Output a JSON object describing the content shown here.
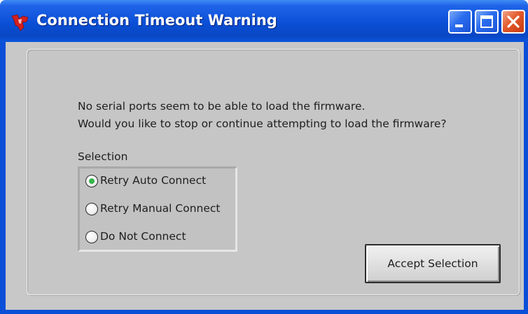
{
  "window": {
    "title": "Connection Timeout Warning",
    "app_icon": "ti-logo-icon",
    "controls": {
      "minimize": "minimize-icon",
      "maximize": "maximize-icon",
      "close": "close-icon"
    }
  },
  "message": {
    "line1": "No serial ports seem to be able to load the firmware.",
    "line2": "Would you like to stop or continue attempting to load the firmware?"
  },
  "selection": {
    "label": "Selection",
    "options": [
      {
        "label": "Retry Auto Connect",
        "selected": true
      },
      {
        "label": "Retry Manual Connect",
        "selected": false
      },
      {
        "label": "Do Not Connect",
        "selected": false
      }
    ]
  },
  "accept_button": {
    "label": "Accept Selection"
  },
  "colors": {
    "titlebar": "#0a4fd6",
    "background": "#c8c8c8",
    "radio_selected": "#35b64a",
    "close_button": "#e25a2c"
  }
}
